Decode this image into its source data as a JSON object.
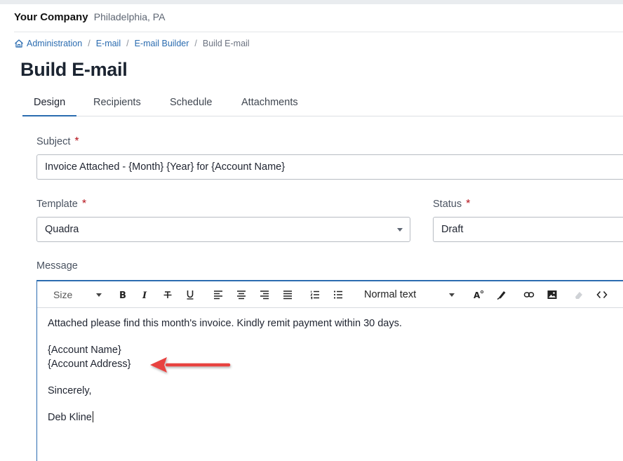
{
  "header": {
    "company_name": "Your Company",
    "location": "Philadelphia, PA"
  },
  "breadcrumb": {
    "items": [
      "Administration",
      "E-mail",
      "E-mail Builder"
    ],
    "current": "Build E-mail",
    "separator": "/"
  },
  "page": {
    "title": "Build E-mail"
  },
  "tabs": [
    {
      "label": "Design",
      "active": true
    },
    {
      "label": "Recipients",
      "active": false
    },
    {
      "label": "Schedule",
      "active": false
    },
    {
      "label": "Attachments",
      "active": false
    }
  ],
  "form": {
    "subject": {
      "label": "Subject",
      "required_mark": "*",
      "value": "Invoice Attached - {Month} {Year} for {Account Name}"
    },
    "template": {
      "label": "Template",
      "required_mark": "*",
      "value": "Quadra"
    },
    "status": {
      "label": "Status",
      "required_mark": "*",
      "value": "Draft"
    },
    "message": {
      "label": "Message"
    }
  },
  "toolbar": {
    "size_label": "Size",
    "format_label": "Normal text",
    "icons": [
      "bold-icon",
      "italic-icon",
      "strikethrough-icon",
      "underline-icon",
      "align-left-icon",
      "align-center-icon",
      "align-right-icon",
      "align-justify-icon",
      "ordered-list-icon",
      "bullet-list-icon",
      "text-color-icon",
      "highlighter-icon",
      "link-icon",
      "image-icon",
      "clear-format-icon",
      "code-view-icon"
    ]
  },
  "message_body": {
    "line1": "Attached please find this month's invoice. Kindly remit payment within 30 days.",
    "line2": "{Account Name}",
    "line3": "{Account Address}",
    "line4": "Sincerely,",
    "line5": "Deb Kline"
  },
  "colors": {
    "accent": "#2b6cb0",
    "required": "#b5121b",
    "annotation_arrow": "#e8423f"
  }
}
